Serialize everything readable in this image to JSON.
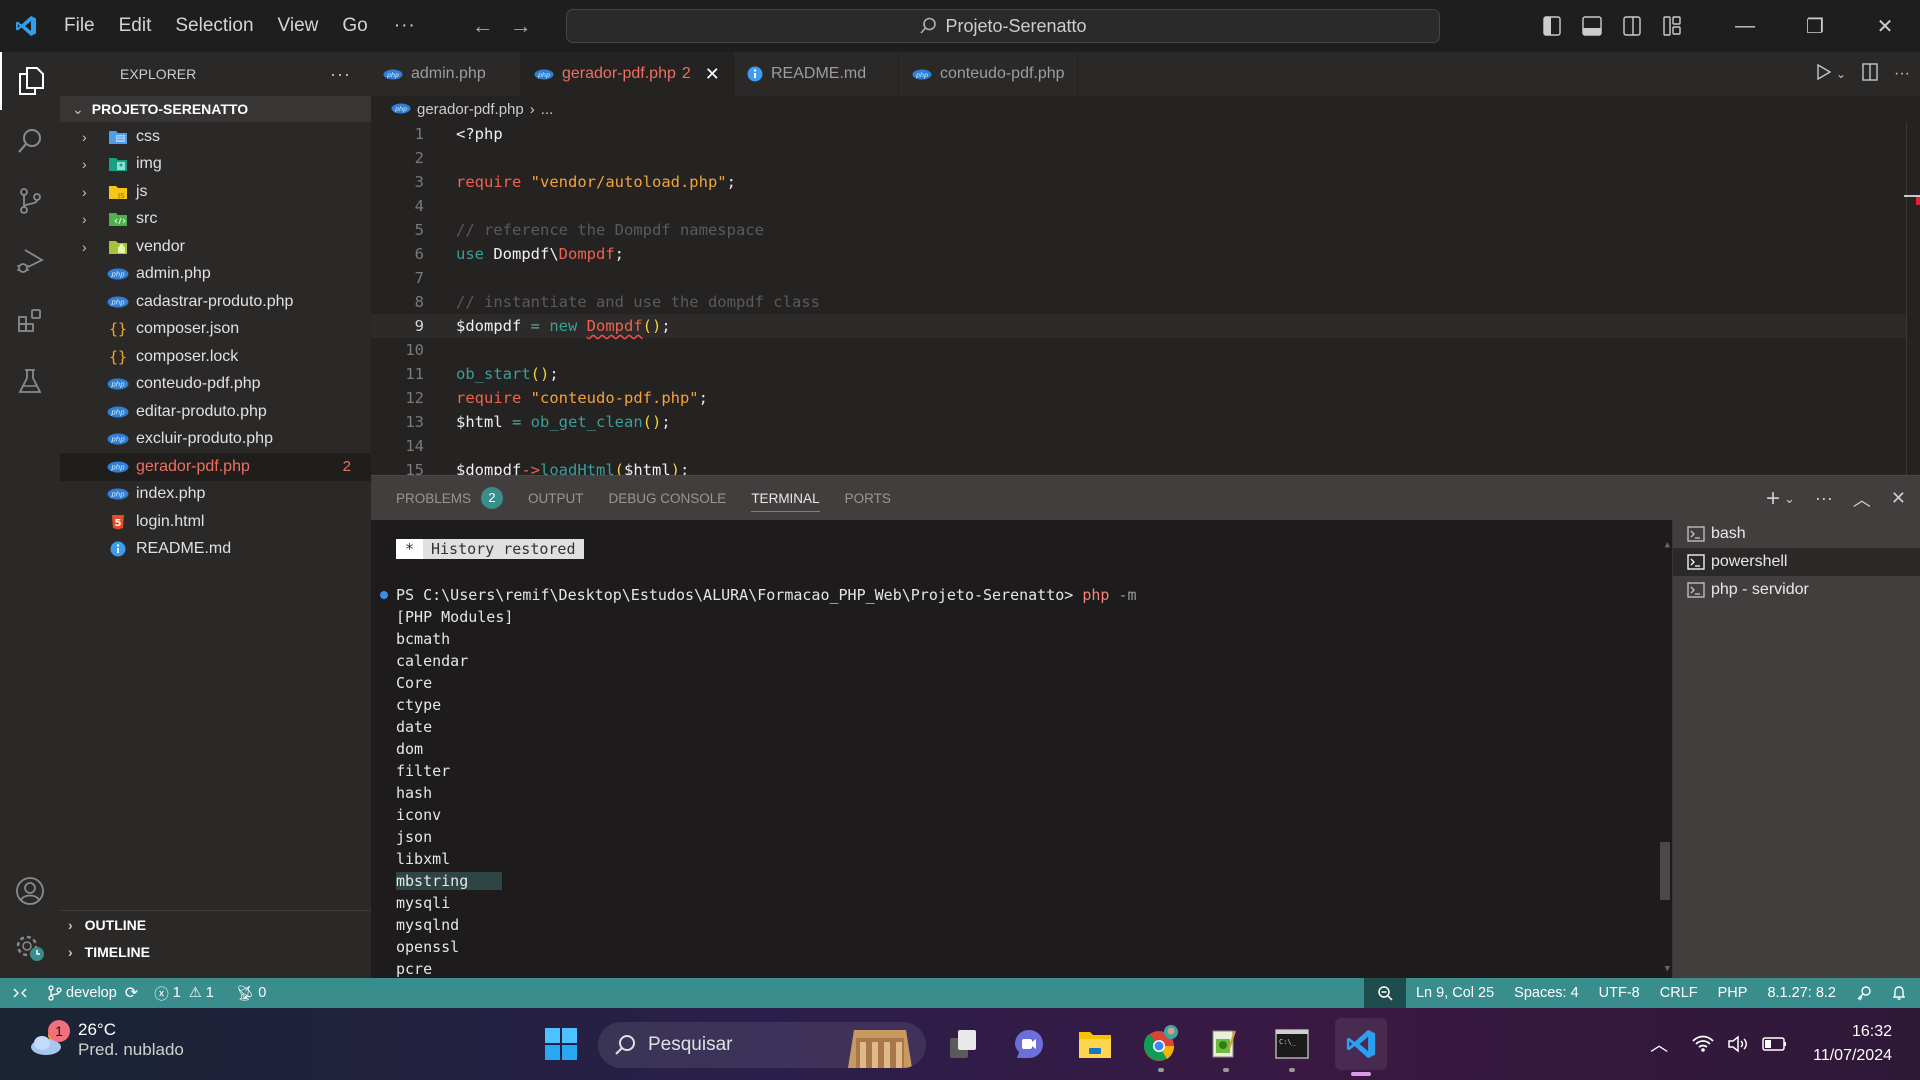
{
  "titlebar": {
    "menu": [
      "File",
      "Edit",
      "Selection",
      "View",
      "Go"
    ],
    "more": "···",
    "command_center": "Projeto-Serenatto",
    "window_buttons": {
      "minimize": "—",
      "restore": "❐",
      "close": "✕"
    }
  },
  "activity_bar": {
    "items": [
      "explorer",
      "search",
      "source-control",
      "run-and-debug",
      "extensions",
      "testing"
    ],
    "bottom": [
      "accounts",
      "manage"
    ]
  },
  "sidebar": {
    "title": "EXPLORER",
    "more": "···",
    "root": "PROJETO-SERENATTO",
    "folders": [
      {
        "name": "css",
        "icon": "folder-css-icon",
        "color": "#4f9ee8"
      },
      {
        "name": "img",
        "icon": "folder-images-icon",
        "color": "#16a085"
      },
      {
        "name": "js",
        "icon": "folder-js-icon",
        "color": "#f5c518"
      },
      {
        "name": "src",
        "icon": "folder-src-icon",
        "color": "#4caf50"
      },
      {
        "name": "vendor",
        "icon": "folder-vendor-icon",
        "color": "#a5c33a"
      }
    ],
    "files": [
      {
        "name": "admin.php",
        "type": "php"
      },
      {
        "name": "cadastrar-produto.php",
        "type": "php"
      },
      {
        "name": "composer.json",
        "type": "json"
      },
      {
        "name": "composer.lock",
        "type": "json"
      },
      {
        "name": "conteudo-pdf.php",
        "type": "php"
      },
      {
        "name": "editar-produto.php",
        "type": "php"
      },
      {
        "name": "excluir-produto.php",
        "type": "php"
      },
      {
        "name": "gerador-pdf.php",
        "type": "php",
        "errors": "2",
        "selected": true
      },
      {
        "name": "index.php",
        "type": "php"
      },
      {
        "name": "login.html",
        "type": "html"
      },
      {
        "name": "README.md",
        "type": "info"
      }
    ],
    "sections": [
      "OUTLINE",
      "TIMELINE"
    ]
  },
  "tabs": [
    {
      "label": "admin.php",
      "type": "php"
    },
    {
      "label": "gerador-pdf.php",
      "type": "php",
      "active": true,
      "problems": "2",
      "close": "✕"
    },
    {
      "label": "README.md",
      "type": "info"
    },
    {
      "label": "conteudo-pdf.php",
      "type": "php"
    }
  ],
  "breadcrumb": {
    "file": "gerador-pdf.php",
    "sep": "›",
    "rest": "..."
  },
  "editor": {
    "current_line": 9,
    "lines": [
      {
        "n": "1"
      },
      {
        "n": "2"
      },
      {
        "n": "3"
      },
      {
        "n": "4"
      },
      {
        "n": "5"
      },
      {
        "n": "6"
      },
      {
        "n": "7"
      },
      {
        "n": "8"
      },
      {
        "n": "9"
      },
      {
        "n": "10"
      },
      {
        "n": "11"
      },
      {
        "n": "12"
      },
      {
        "n": "13"
      },
      {
        "n": "14"
      },
      {
        "n": "15"
      }
    ],
    "code": {
      "l1": "<?php",
      "l3_kw": "require",
      "l3_str": "\"vendor/autoload.php\"",
      "l3_end": ";",
      "l5": "// reference the Dompdf namespace",
      "l6_kw": "use",
      "l6_ns": "Dompdf\\",
      "l6_cls": "Dompdf",
      "l6_end": ";",
      "l8": "// instantiate and use the dompdf class",
      "l9_var": "$dompdf",
      "l9_op": " = ",
      "l9_new": "new",
      "l9_cls": "Dompdf",
      "l9_par": "()",
      "l9_end": ";",
      "l11_fn": "ob_start",
      "l11_par": "()",
      "l11_end": ";",
      "l12_kw": "require",
      "l12_str": "\"conteudo-pdf.php\"",
      "l12_end": ";",
      "l13_var": "$html",
      "l13_op": " = ",
      "l13_fn": "ob_get_clean",
      "l13_par": "()",
      "l13_end": ";",
      "l15_var": "$dompdf",
      "l15_arrow": "->",
      "l15_fn": "loadHtml",
      "l15_p1": "(",
      "l15_arg": "$html",
      "l15_p2": ")",
      "l15_end": ";"
    }
  },
  "panel": {
    "tabs": [
      {
        "label": "PROBLEMS",
        "badge": "2"
      },
      {
        "label": "OUTPUT"
      },
      {
        "label": "DEBUG CONSOLE"
      },
      {
        "label": "TERMINAL",
        "active": true
      },
      {
        "label": "PORTS"
      }
    ],
    "actions": {
      "add": "+",
      "dropdown": "⌄",
      "more": "···",
      "maximize": "︿",
      "close": "✕"
    }
  },
  "terminal": {
    "history_star": "*",
    "history_text": "History restored",
    "prompt": "PS C:\\Users\\remif\\Desktop\\Estudos\\ALURA\\Formacao_PHP_Web\\Projeto-Serenatto> ",
    "command": "php",
    "flag": " -m",
    "output": [
      "[PHP Modules]",
      "bcmath",
      "calendar",
      "Core",
      "ctype",
      "date",
      "dom",
      "filter",
      "hash",
      "iconv",
      "json",
      "libxml",
      "mbstring",
      "mysqli",
      "mysqlnd",
      "openssl",
      "pcre"
    ],
    "selected_line": "mbstring",
    "instances": [
      {
        "label": "bash"
      },
      {
        "label": "powershell",
        "active": true
      },
      {
        "label": "php - servidor"
      }
    ]
  },
  "statusbar": {
    "branch": "develop",
    "errors": "1",
    "warnings": "1",
    "ports": "0",
    "position": "Ln 9, Col 25",
    "spaces": "Spaces: 4",
    "encoding": "UTF-8",
    "eol": "CRLF",
    "language": "PHP",
    "php_version": "8.1.27: 8.2"
  },
  "taskbar": {
    "weather_badge": "1",
    "temperature": "26°C",
    "condition": "Pred. nublado",
    "search": "Pesquisar",
    "time": "16:32",
    "date": "11/07/2024",
    "colors": {
      "accent": "#d79be8"
    }
  },
  "colors": {
    "statusbar": "#3a8d8d",
    "error": "#f0705f",
    "sidebar_bg": "#2b2828",
    "editor_bg": "#252222"
  }
}
